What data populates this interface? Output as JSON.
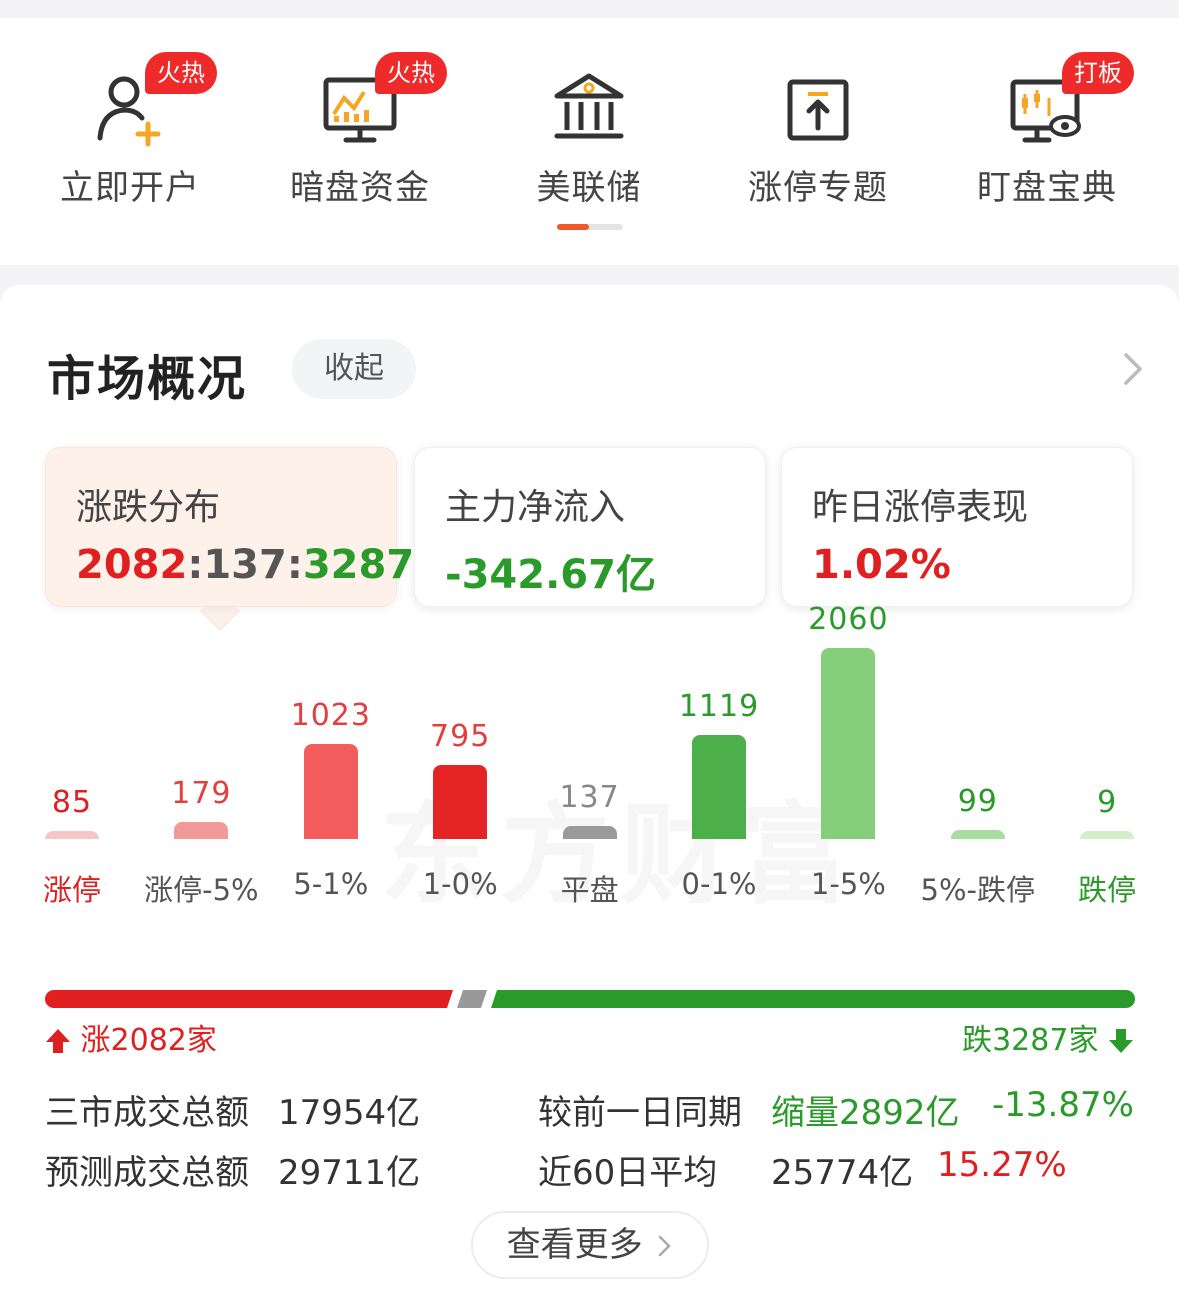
{
  "quick_nav": {
    "items": [
      {
        "label": "立即开户",
        "badge": "火热",
        "icon": "user-add-icon"
      },
      {
        "label": "暗盘资金",
        "badge": "火热",
        "icon": "monitor-chart-icon"
      },
      {
        "label": "美联储",
        "badge": "",
        "icon": "bank-icon"
      },
      {
        "label": "涨停专题",
        "badge": "",
        "icon": "arrow-up-box-icon"
      },
      {
        "label": "盯盘宝典",
        "badge": "打板",
        "icon": "monitor-eye-icon"
      }
    ],
    "colors": {
      "badge": "#ee2a2a",
      "indicator": "#ee5a2a"
    }
  },
  "market": {
    "title": "市场概况",
    "collapse_label": "收起",
    "tabs": [
      {
        "title": "涨跌分布",
        "value_up": "2082",
        "value_flat": "137",
        "value_down": "3287",
        "sep": ":"
      },
      {
        "title": "主力净流入",
        "value": "-342.67亿"
      },
      {
        "title": "昨日涨停表现",
        "value": "1.02%"
      }
    ],
    "watermark": "东方财富",
    "up_count_text": "涨2082家",
    "down_count_text": "跌3287家",
    "stats": {
      "turnover_label": "三市成交总额",
      "turnover_value": "17954亿",
      "compare_label": "较前一日同期",
      "compare_value": "缩量2892亿",
      "compare_pct": "-13.87%",
      "forecast_label": "预测成交总额",
      "forecast_value": "29711亿",
      "avg_label": "近60日平均",
      "avg_value": "25774亿",
      "avg_pct": "15.27%"
    },
    "more_label": "查看更多"
  },
  "colors": {
    "up": "#e02020",
    "down": "#2a9a2a",
    "flat": "#999999"
  },
  "chart_data": {
    "type": "bar",
    "categories": [
      "涨停",
      "涨停-5%",
      "5-1%",
      "1-0%",
      "平盘",
      "0-1%",
      "1-5%",
      "5%-跌停",
      "跌停"
    ],
    "values": [
      85,
      179,
      1023,
      795,
      137,
      1119,
      2060,
      99,
      9
    ],
    "value_labels": [
      "85",
      "179",
      "1023",
      "795",
      "137",
      "1119",
      "2060",
      "99",
      "9"
    ],
    "colors": [
      "#f7c6c6",
      "#f29a9a",
      "#f25c5c",
      "#e52424",
      "#9a9a9a",
      "#4caf4a",
      "#86cf7a",
      "#a8dca0",
      "#d2eecb"
    ],
    "label_colors": [
      "#e02020",
      "#e04040",
      "#e04040",
      "#e04040",
      "#888888",
      "#2a9a2a",
      "#2a9a2a",
      "#2a9a2a",
      "#2a9a2a"
    ],
    "category_label_colors": [
      "#e02020",
      "#555555",
      "#555555",
      "#555555",
      "#555555",
      "#555555",
      "#555555",
      "#555555",
      "#2a9a2a"
    ]
  },
  "distribution": {
    "up": 2082,
    "flat": 137,
    "down": 3287
  }
}
